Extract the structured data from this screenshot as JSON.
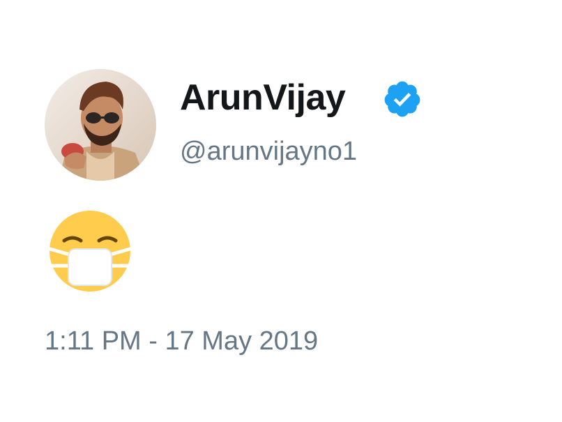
{
  "user": {
    "display_name": "ArunVijay",
    "handle": "@arunvijayno1",
    "verified": true,
    "avatar_icon": "profile-photo",
    "verified_icon": "verified-badge-icon"
  },
  "tweet": {
    "content_emoji": "face-with-medical-mask",
    "timestamp": "1:11 PM - 17 May 2019"
  },
  "colors": {
    "name": "#14171a",
    "secondary_text": "#657786",
    "verified_blue": "#1da1f2",
    "emoji_yellow": "#ffcc4d"
  }
}
